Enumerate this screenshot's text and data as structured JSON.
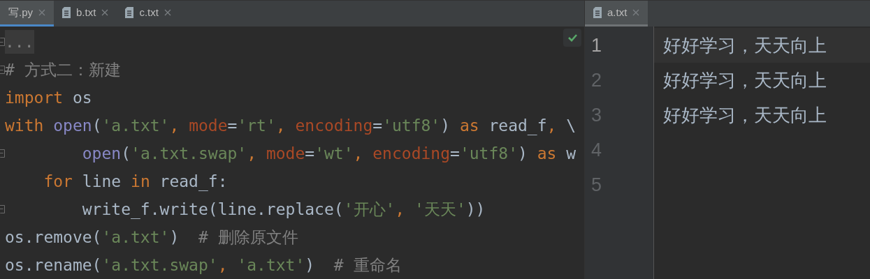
{
  "left_tabs": [
    {
      "label": "写.py",
      "selected": true,
      "kind": "python"
    },
    {
      "label": "b.txt",
      "selected": false,
      "kind": "text"
    },
    {
      "label": "c.txt",
      "selected": false,
      "kind": "text"
    }
  ],
  "left_editor": {
    "inspection_passed": true,
    "lines": [
      {
        "kind": "fold_start",
        "folded": true,
        "tokens": [
          {
            "kind": "fold",
            "text": "..."
          }
        ]
      },
      {
        "kind": "fold_start",
        "folded": false,
        "tokens": [
          {
            "kind": "comment",
            "text": "# 方式二：新建"
          }
        ]
      },
      {
        "kind": "plain",
        "folded": false,
        "tokens": [
          {
            "kind": "keyword",
            "text": "import"
          },
          {
            "kind": "plain",
            "text": " os"
          }
        ]
      },
      {
        "kind": "plain",
        "folded": false,
        "tokens": [
          {
            "kind": "keyword",
            "text": "with "
          },
          {
            "kind": "func",
            "text": "open"
          },
          {
            "kind": "plain",
            "text": "("
          },
          {
            "kind": "string",
            "text": "'a.txt'"
          },
          {
            "kind": "keyword",
            "text": ", "
          },
          {
            "kind": "param",
            "text": "mode"
          },
          {
            "kind": "plain",
            "text": "="
          },
          {
            "kind": "string",
            "text": "'rt'"
          },
          {
            "kind": "keyword",
            "text": ", "
          },
          {
            "kind": "param",
            "text": "encoding"
          },
          {
            "kind": "plain",
            "text": "="
          },
          {
            "kind": "string",
            "text": "'utf8'"
          },
          {
            "kind": "plain",
            "text": ") "
          },
          {
            "kind": "keyword",
            "text": "as"
          },
          {
            "kind": "plain",
            "text": " read_f"
          },
          {
            "kind": "keyword",
            "text": ","
          },
          {
            "kind": "plain",
            "text": " \\"
          }
        ]
      },
      {
        "kind": "fold_end",
        "folded": false,
        "tokens": [
          {
            "kind": "func",
            "text": "        open"
          },
          {
            "kind": "plain",
            "text": "("
          },
          {
            "kind": "string",
            "text": "'a.txt.swap'"
          },
          {
            "kind": "keyword",
            "text": ", "
          },
          {
            "kind": "param",
            "text": "mode"
          },
          {
            "kind": "plain",
            "text": "="
          },
          {
            "kind": "string",
            "text": "'wt'"
          },
          {
            "kind": "keyword",
            "text": ", "
          },
          {
            "kind": "param",
            "text": "encoding"
          },
          {
            "kind": "plain",
            "text": "="
          },
          {
            "kind": "string",
            "text": "'utf8'"
          },
          {
            "kind": "plain",
            "text": ") "
          },
          {
            "kind": "keyword",
            "text": "as"
          },
          {
            "kind": "plain",
            "text": " w"
          }
        ]
      },
      {
        "kind": "plain",
        "folded": false,
        "tokens": [
          {
            "kind": "keyword",
            "text": "    for"
          },
          {
            "kind": "plain",
            "text": " line "
          },
          {
            "kind": "keyword",
            "text": "in"
          },
          {
            "kind": "plain",
            "text": " read_f:"
          }
        ]
      },
      {
        "kind": "fold_end",
        "folded": false,
        "tokens": [
          {
            "kind": "plain",
            "text": "        write_f.write(line.replace("
          },
          {
            "kind": "string",
            "text": "'开心'"
          },
          {
            "kind": "keyword",
            "text": ", "
          },
          {
            "kind": "string",
            "text": "'天天'"
          },
          {
            "kind": "plain",
            "text": "))"
          }
        ]
      },
      {
        "kind": "plain",
        "folded": false,
        "tokens": [
          {
            "kind": "plain",
            "text": "os.remove("
          },
          {
            "kind": "string",
            "text": "'a.txt'"
          },
          {
            "kind": "plain",
            "text": ")  "
          },
          {
            "kind": "comment",
            "text": "# 删除原文件"
          }
        ]
      },
      {
        "kind": "plain",
        "folded": false,
        "tokens": [
          {
            "kind": "plain",
            "text": "os.rename("
          },
          {
            "kind": "string",
            "text": "'a.txt.swap'"
          },
          {
            "kind": "keyword",
            "text": ", "
          },
          {
            "kind": "string",
            "text": "'a.txt'"
          },
          {
            "kind": "plain",
            "text": ")  "
          },
          {
            "kind": "comment",
            "text": "# 重命名"
          }
        ]
      }
    ]
  },
  "right_tabs": [
    {
      "label": "a.txt",
      "selected": true,
      "kind": "text"
    }
  ],
  "right_editor": {
    "lines": [
      {
        "number": "1",
        "text": "好好学习，天天向上",
        "current": true
      },
      {
        "number": "2",
        "text": "好好学习，天天向上",
        "current": false
      },
      {
        "number": "3",
        "text": "好好学习，天天向上",
        "current": false
      },
      {
        "number": "4",
        "current": false
      },
      {
        "number": "5",
        "current": false
      }
    ]
  }
}
